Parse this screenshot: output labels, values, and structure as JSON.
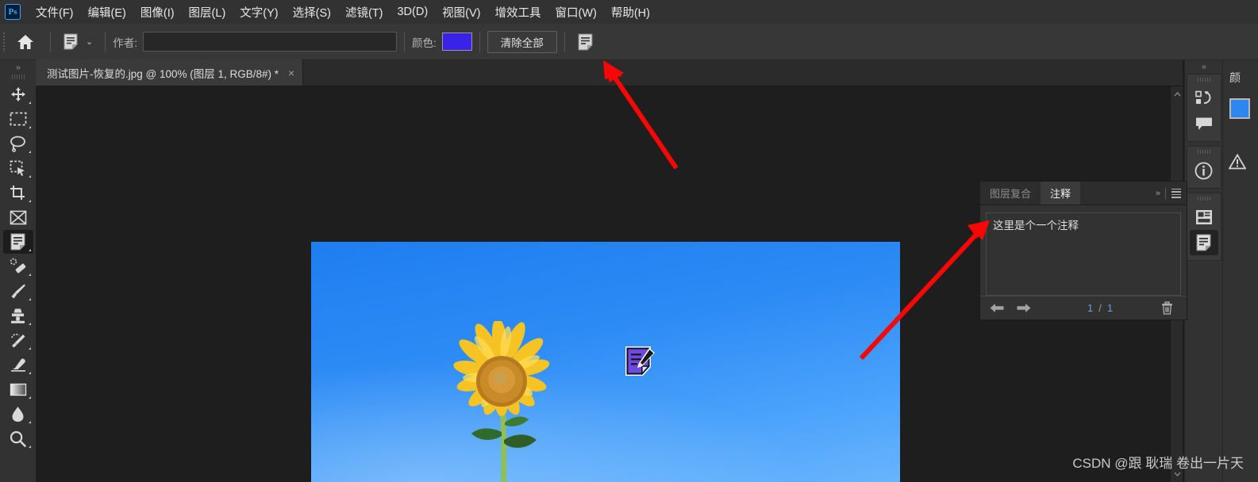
{
  "app": {
    "logo_text": "Ps",
    "watermark": "CSDN @跟 耿瑞 卷出一片天"
  },
  "menubar": {
    "items": [
      {
        "label": "文件(F)",
        "name": "menu-file"
      },
      {
        "label": "编辑(E)",
        "name": "menu-edit"
      },
      {
        "label": "图像(I)",
        "name": "menu-image"
      },
      {
        "label": "图层(L)",
        "name": "menu-layer"
      },
      {
        "label": "文字(Y)",
        "name": "menu-type"
      },
      {
        "label": "选择(S)",
        "name": "menu-select"
      },
      {
        "label": "滤镜(T)",
        "name": "menu-filter"
      },
      {
        "label": "3D(D)",
        "name": "menu-3d"
      },
      {
        "label": "视图(V)",
        "name": "menu-view"
      },
      {
        "label": "增效工具",
        "name": "menu-plugins"
      },
      {
        "label": "窗口(W)",
        "name": "menu-window"
      },
      {
        "label": "帮助(H)",
        "name": "menu-help"
      }
    ]
  },
  "optionsbar": {
    "home_icon": "home-icon",
    "tool_preset_icon": "note-tool-icon",
    "tool_preset_chevron": "⌄",
    "author_label": "作者:",
    "author_value": "",
    "author_placeholder": "",
    "color_label": "颜色:",
    "color_value": "#3a23e8",
    "clear_all_label": "清除全部",
    "notes_panel_toggle_icon": "notes-panel-icon"
  },
  "toolbar": {
    "expand_label": "»",
    "tools": [
      {
        "name": "move-tool",
        "label": "移动工具",
        "active": false
      },
      {
        "name": "marquee-tool",
        "label": "矩形选框工具",
        "active": false
      },
      {
        "name": "lasso-tool",
        "label": "套索工具",
        "active": false
      },
      {
        "name": "quick-selection-tool",
        "label": "快速选择工具",
        "active": false
      },
      {
        "name": "crop-tool",
        "label": "裁剪工具",
        "active": false
      },
      {
        "name": "frame-tool",
        "label": "画框工具",
        "active": false
      },
      {
        "name": "note-tool",
        "label": "注释工具",
        "active": true
      },
      {
        "name": "healing-brush-tool",
        "label": "修复画笔工具",
        "active": false
      },
      {
        "name": "brush-tool",
        "label": "画笔工具",
        "active": false
      },
      {
        "name": "clone-stamp-tool",
        "label": "仿制图章工具",
        "active": false
      },
      {
        "name": "history-brush-tool",
        "label": "历史记录画笔工具",
        "active": false
      },
      {
        "name": "eraser-tool",
        "label": "橡皮擦工具",
        "active": false
      },
      {
        "name": "gradient-tool",
        "label": "渐变工具",
        "active": false
      },
      {
        "name": "blur-tool",
        "label": "模糊工具",
        "active": false
      },
      {
        "name": "zoom-tool",
        "label": "缩放工具",
        "active": false
      }
    ]
  },
  "document": {
    "tab_title": "测试图片-恢复的.jpg @ 100% (图层 1, RGB/8#) *",
    "close_glyph": "×",
    "canvas_note_marker": "note-marker-icon"
  },
  "scrollbar": {
    "up_glyph": "▲",
    "down_glyph": "▼"
  },
  "notes_panel": {
    "tabs": [
      {
        "label": "图层复合",
        "name": "tab-layer-comps",
        "active": false
      },
      {
        "label": "注释",
        "name": "tab-notes",
        "active": true
      }
    ],
    "collapse_glyph": "»",
    "menu_icon": "panel-menu-icon",
    "note_text": "这里是个一个注释",
    "note_placeholder": "",
    "prev_icon": "arrow-left-icon",
    "next_icon": "arrow-right-icon",
    "page_current": "1",
    "page_separator": "/",
    "page_total": "1",
    "delete_icon": "trash-icon"
  },
  "dock": {
    "collapse_glyph": "«",
    "groups": [
      {
        "icons": [
          {
            "name": "history-icon",
            "active": false
          },
          {
            "name": "comment-bubble-icon",
            "active": false
          }
        ]
      },
      {
        "icons": [
          {
            "name": "info-icon",
            "active": false
          }
        ]
      },
      {
        "icons": [
          {
            "name": "layers-icon",
            "active": false
          },
          {
            "name": "notes-icon",
            "active": true
          }
        ]
      }
    ]
  },
  "right_strip": {
    "label": "颜",
    "swatch_color": "#2e86f0",
    "warning_icon": "warning-triangle-icon"
  },
  "annotations": {
    "arrow_1": "red-arrow-pointing-to-notes-panel-toggle",
    "arrow_2": "red-arrow-pointing-to-notes-panel",
    "color": "#fb0505"
  }
}
